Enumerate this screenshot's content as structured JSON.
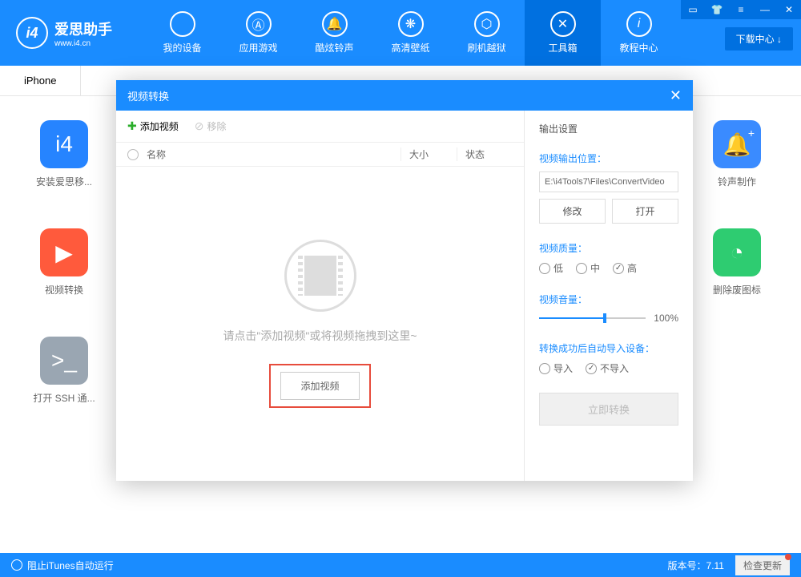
{
  "app": {
    "logo_text": "爱思助手",
    "logo_sub": "www.i4.cn",
    "logo_badge": "i4"
  },
  "nav": [
    {
      "label": "我的设备",
      "icon": "apple"
    },
    {
      "label": "应用游戏",
      "icon": "app"
    },
    {
      "label": "酷炫铃声",
      "icon": "bell"
    },
    {
      "label": "高清壁纸",
      "icon": "flower"
    },
    {
      "label": "刷机越狱",
      "icon": "box"
    },
    {
      "label": "工具箱",
      "icon": "wrench",
      "active": true
    },
    {
      "label": "教程中心",
      "icon": "info"
    }
  ],
  "download_center": "下载中心 ↓",
  "tab": {
    "label": "iPhone"
  },
  "tools": [
    {
      "label": "安装爱思移...",
      "color": "#2684ff"
    },
    {
      "label": "铃声制作",
      "color": "#3a8bff"
    },
    {
      "label": "视频转换",
      "color": "#ff5a3c"
    },
    {
      "label": "删除废图标",
      "color": "#2ecc71"
    },
    {
      "label": "打开 SSH 通...",
      "color": "#9aa6b2"
    }
  ],
  "modal": {
    "title": "视频转换",
    "toolbar": {
      "add": "添加视频",
      "remove": "移除"
    },
    "table": {
      "name": "名称",
      "size": "大小",
      "status": "状态"
    },
    "dropzone": {
      "hint": "请点击\"添加视频\"或将视频拖拽到这里~",
      "button": "添加视频"
    },
    "settings": {
      "title": "输出设置",
      "output_path_label": "视频输出位置：",
      "output_path": "E:\\i4Tools7\\Files\\ConvertVideo",
      "modify": "修改",
      "open": "打开",
      "quality_label": "视频质量：",
      "quality_low": "低",
      "quality_mid": "中",
      "quality_high": "高",
      "volume_label": "视频音量：",
      "volume_value": "100%",
      "import_label": "转换成功后自动导入设备：",
      "import_yes": "导入",
      "import_no": "不导入",
      "convert_btn": "立即转换"
    }
  },
  "footer": {
    "itunes": "阻止iTunes自动运行",
    "version_label": "版本号：",
    "version": "7.11",
    "update": "检查更新"
  }
}
